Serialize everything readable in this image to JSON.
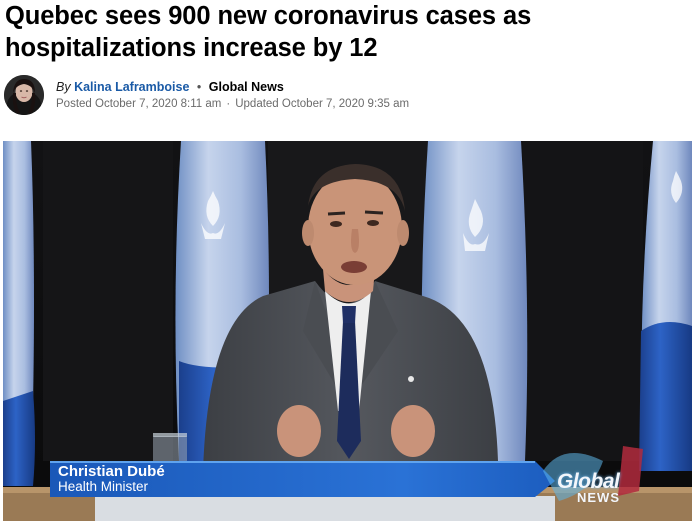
{
  "article": {
    "headline": "Quebec sees 900 new coronavirus cases as hospitalizations increase by 12",
    "byline": {
      "by": "By",
      "author": "Kalina Laframboise",
      "separator": "•",
      "source": "Global News"
    },
    "dates": {
      "posted": "Posted October 7, 2020 8:11 am",
      "separator": "·",
      "updated": "Updated October 7, 2020 9:35 am"
    }
  },
  "photo": {
    "lower_third": {
      "name": "Christian Dubé",
      "title": "Health Minister"
    },
    "brand": {
      "line1": "Global",
      "line2": "NEWS"
    }
  },
  "colors": {
    "author_link": "#1a5aa6",
    "lower_third_blue": "#1d63c4",
    "flag_blue": "#1f4ea6"
  },
  "icons": {
    "avatar": "author-avatar",
    "fleur": "fleur-de-lis-icon"
  }
}
